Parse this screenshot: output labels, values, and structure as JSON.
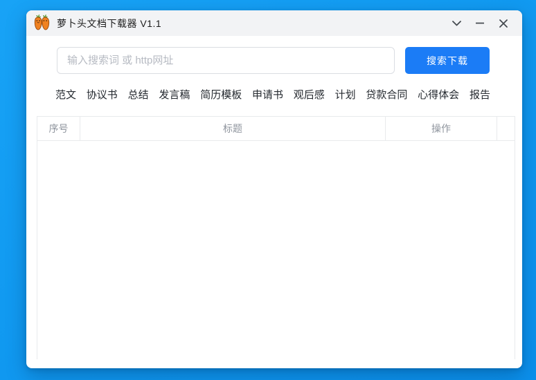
{
  "window": {
    "title": "萝卜头文档下载器 V1.1",
    "icons": {
      "app": "carrot-heads-icon",
      "menu": "chevron-down-icon",
      "minimize": "minimize-icon",
      "close": "close-icon"
    }
  },
  "search": {
    "placeholder": "输入搜索词 或 http网址",
    "value": "",
    "button_label": "搜索下载"
  },
  "tabs": [
    "范文",
    "协议书",
    "总结",
    "发言稿",
    "简历模板",
    "申请书",
    "观后感",
    "计划",
    "贷款合同",
    "心得体会",
    "报告"
  ],
  "table": {
    "columns": [
      "序号",
      "标题",
      "操作"
    ],
    "rows": []
  },
  "colors": {
    "accent": "#1b7cf6",
    "desktop_background": "#119af1",
    "titlebar_background": "#f2f3f5",
    "table_border": "#e8eaec",
    "header_text": "#8f959e"
  }
}
